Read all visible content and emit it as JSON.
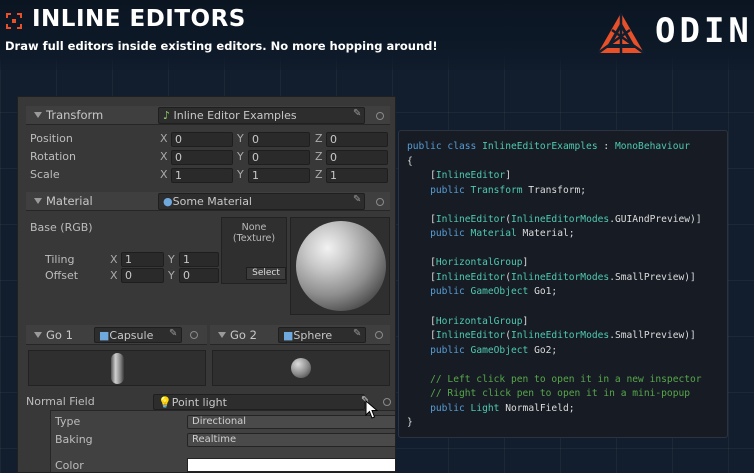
{
  "header": {
    "title": "INLINE EDITORS",
    "subtitle": "Draw full editors inside existing editors. No more hopping around!",
    "logo_text": "ODIN",
    "accent": "#e8502a"
  },
  "inspector": {
    "transform": {
      "title": "Transform",
      "object": "Inline Editor Examples",
      "rows": [
        {
          "label": "Position",
          "x": "0",
          "y": "0",
          "z": "0"
        },
        {
          "label": "Rotation",
          "x": "0",
          "y": "0",
          "z": "0"
        },
        {
          "label": "Scale",
          "x": "1",
          "y": "1",
          "z": "1"
        }
      ]
    },
    "material": {
      "title": "Material",
      "object": "Some Material",
      "base": "Base (RGB)",
      "texture": "None\n(Texture)",
      "select": "Select",
      "tiling": {
        "label": "Tiling",
        "x": "1",
        "y": "1"
      },
      "offset": {
        "label": "Offset",
        "x": "0",
        "y": "0"
      }
    },
    "go1": {
      "title": "Go 1",
      "object": "Capsule"
    },
    "go2": {
      "title": "Go 2",
      "object": "Sphere"
    },
    "normal": {
      "label": "Normal Field",
      "object": "Point light",
      "type_label": "Type",
      "type_value": "Directional",
      "baking_label": "Baking",
      "baking_value": "Realtime",
      "color_label": "Color"
    },
    "axes": {
      "x": "X",
      "y": "Y",
      "z": "Z"
    }
  },
  "code": {
    "lines": [
      [
        [
          "kw",
          "public class "
        ],
        [
          "ty",
          "InlineEditorExamples"
        ],
        [
          "pl",
          " : "
        ],
        [
          "ty",
          "MonoBehaviour"
        ]
      ],
      [
        [
          "pl",
          "{"
        ]
      ],
      [
        [
          "pl",
          "    ["
        ],
        [
          "at",
          "InlineEditor"
        ],
        [
          "pl",
          "]"
        ]
      ],
      [
        [
          "kw",
          "    public "
        ],
        [
          "ty",
          "Transform"
        ],
        [
          "pl",
          " Transform;"
        ]
      ],
      [
        [
          "pl",
          ""
        ]
      ],
      [
        [
          "pl",
          "    ["
        ],
        [
          "at",
          "InlineEditor"
        ],
        [
          "pl",
          "("
        ],
        [
          "ty",
          "InlineEditorModes"
        ],
        [
          "pl",
          ".GUIAndPreview)]"
        ]
      ],
      [
        [
          "kw",
          "    public "
        ],
        [
          "ty",
          "Material"
        ],
        [
          "pl",
          " Material;"
        ]
      ],
      [
        [
          "pl",
          ""
        ]
      ],
      [
        [
          "pl",
          "    ["
        ],
        [
          "at",
          "HorizontalGroup"
        ],
        [
          "pl",
          "]"
        ]
      ],
      [
        [
          "pl",
          "    ["
        ],
        [
          "at",
          "InlineEditor"
        ],
        [
          "pl",
          "("
        ],
        [
          "ty",
          "InlineEditorModes"
        ],
        [
          "pl",
          ".SmallPreview)]"
        ]
      ],
      [
        [
          "kw",
          "    public "
        ],
        [
          "ty",
          "GameObject"
        ],
        [
          "pl",
          " Go1;"
        ]
      ],
      [
        [
          "pl",
          ""
        ]
      ],
      [
        [
          "pl",
          "    ["
        ],
        [
          "at",
          "HorizontalGroup"
        ],
        [
          "pl",
          "]"
        ]
      ],
      [
        [
          "pl",
          "    ["
        ],
        [
          "at",
          "InlineEditor"
        ],
        [
          "pl",
          "("
        ],
        [
          "ty",
          "InlineEditorModes"
        ],
        [
          "pl",
          ".SmallPreview)]"
        ]
      ],
      [
        [
          "kw",
          "    public "
        ],
        [
          "ty",
          "GameObject"
        ],
        [
          "pl",
          " Go2;"
        ]
      ],
      [
        [
          "pl",
          ""
        ]
      ],
      [
        [
          "cm",
          "    // Left click pen to open it in a new inspector"
        ]
      ],
      [
        [
          "cm",
          "    // Right click pen to open it in a mini-popup"
        ]
      ],
      [
        [
          "kw",
          "    public "
        ],
        [
          "ty",
          "Light"
        ],
        [
          "pl",
          " NormalField;"
        ]
      ],
      [
        [
          "pl",
          "}"
        ]
      ]
    ]
  }
}
